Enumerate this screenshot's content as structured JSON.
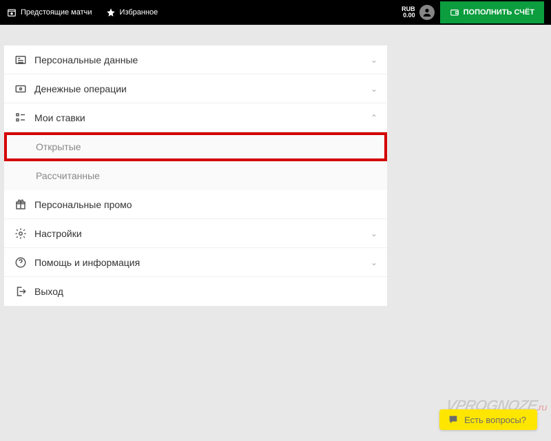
{
  "topbar": {
    "upcoming_label": "Предстоящие матчи",
    "favorites_label": "Избранное",
    "currency": "RUB",
    "balance": "0.00",
    "topup_label": "ПОПОЛНИТЬ СЧЁТ"
  },
  "menu": {
    "personal_data": "Персональные данные",
    "money_ops": "Денежные операции",
    "my_bets": "Мои ставки",
    "my_bets_sub": {
      "open": "Открытые",
      "settled": "Рассчитанные"
    },
    "promo": "Персональные промо",
    "settings": "Настройки",
    "help": "Помощь и информация",
    "logout": "Выход"
  },
  "help_bubble": "Есть вопросы?",
  "watermark": {
    "main": "VPROGNOZE",
    "suffix": ".ru"
  }
}
